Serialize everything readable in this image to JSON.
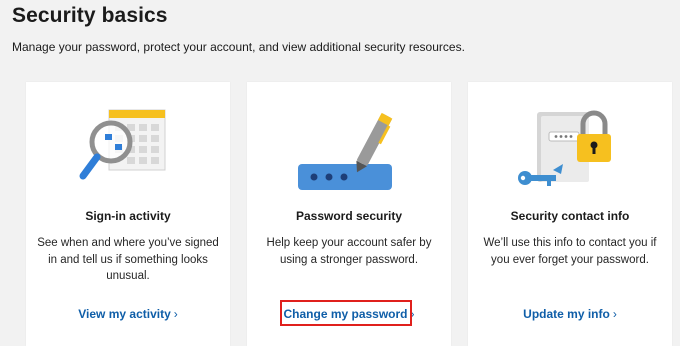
{
  "header": {
    "title": "Security basics",
    "subtitle": "Manage your password, protect your account, and view additional security resources."
  },
  "cards": [
    {
      "title": "Sign-in activity",
      "desc_lines": [
        "See when and where you’ve signed",
        "in and tell us if something looks",
        "unusual."
      ],
      "link": "View my activity",
      "icon": "magnifier-calendar-icon"
    },
    {
      "title": "Password security",
      "desc_lines": [
        "Help keep your account safer by",
        "using a stronger password."
      ],
      "link": "Change my password",
      "icon": "pen-password-field-icon"
    },
    {
      "title": "Security contact info",
      "desc_lines": [
        "We’ll use this info to contact you if",
        "you ever forget your password."
      ],
      "link": "Update my info",
      "icon": "key-lock-book-icon"
    }
  ],
  "chevron": "›",
  "colors": {
    "link": "#0f5ea8",
    "highlight": "#e0201c",
    "accent_yellow": "#f6c01f",
    "accent_blue": "#3e8ed0"
  }
}
